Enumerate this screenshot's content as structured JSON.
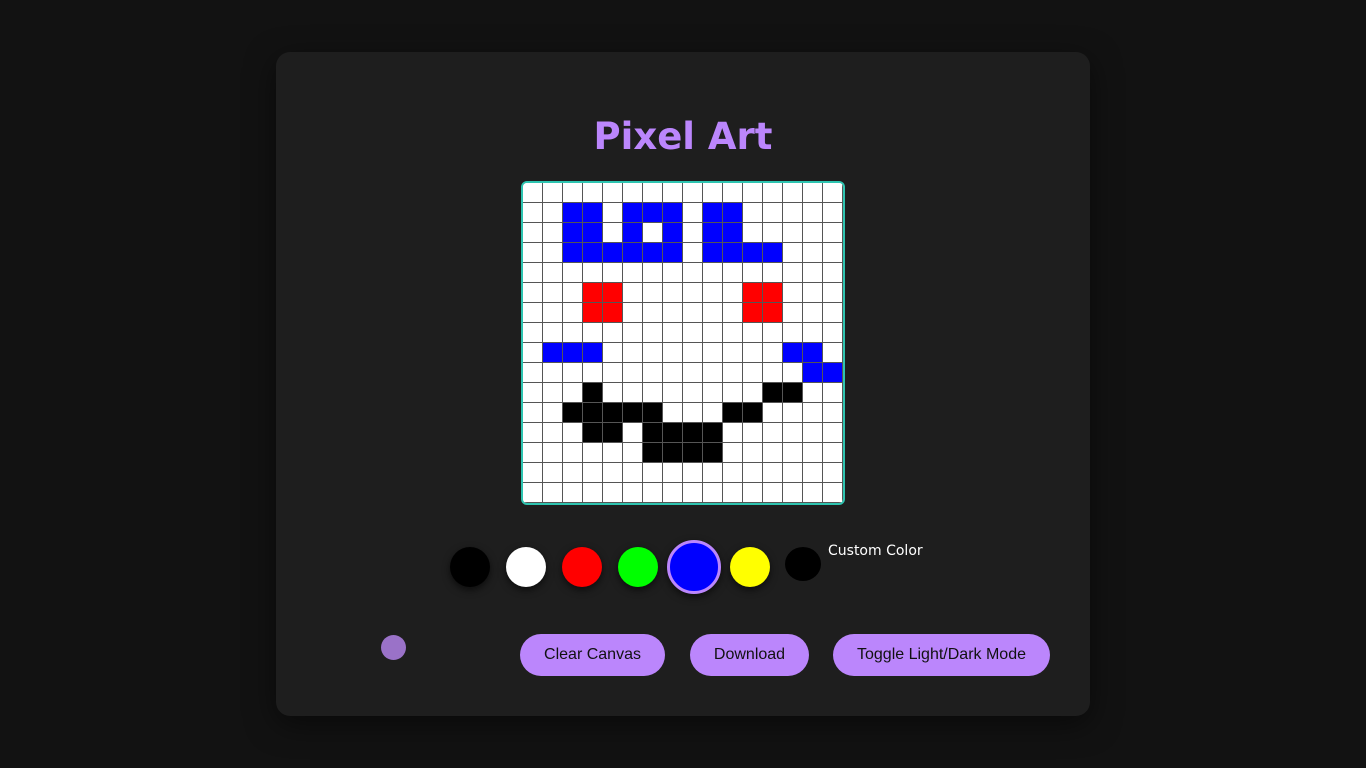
{
  "app": {
    "title": "Pixel Art"
  },
  "canvas": {
    "cols": 16,
    "rows": 16,
    "background": "#ffffff",
    "grid_line_color": "#555555",
    "border_color": "#2ec4b0",
    "rows_pattern": [
      "................",
      "..BB.BBB.BB.....",
      "..BB.B.B.BB.....",
      "..BBBBBB.BBBB...",
      "................",
      "...RR......RR...",
      "...RR......RR...",
      "................",
      ".BBB.........BB.",
      "..............BB",
      "...K........KK..",
      "..KKKKK...KK....",
      "...KK.KKKK......",
      "......KKKK......",
      "................",
      "................"
    ],
    "palette_map": {
      "B": "#0000ff",
      "R": "#ff0000",
      "K": "#000000"
    }
  },
  "palette": {
    "swatches": [
      {
        "name": "black",
        "color": "#000000",
        "selected": false
      },
      {
        "name": "white",
        "color": "#ffffff",
        "selected": false
      },
      {
        "name": "red",
        "color": "#ff0000",
        "selected": false
      },
      {
        "name": "green",
        "color": "#00ff00",
        "selected": false
      },
      {
        "name": "blue",
        "color": "#0000ff",
        "selected": true
      },
      {
        "name": "yellow",
        "color": "#ffff00",
        "selected": false
      }
    ],
    "custom_color_value": "#000000",
    "custom_color_label": "Custom Color"
  },
  "controls": {
    "brush_indicator_color": "#9a72c8",
    "clear_label": "Clear Canvas",
    "download_label": "Download",
    "toggle_theme_label": "Toggle Light/Dark Mode"
  }
}
